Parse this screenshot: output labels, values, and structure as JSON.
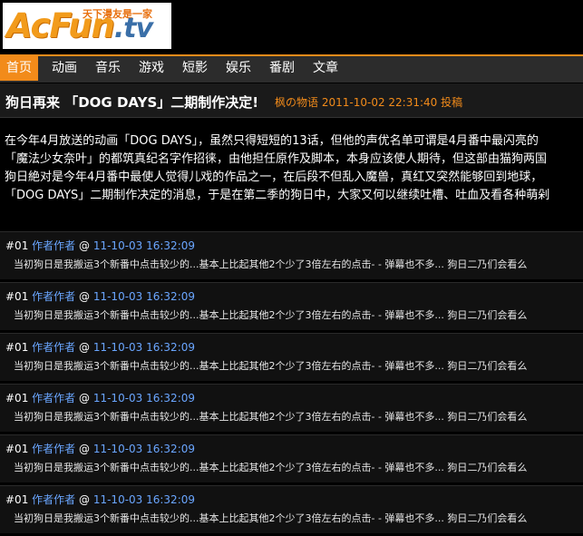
{
  "logo": {
    "brand_a": "AcFun",
    "brand_b": ".tv",
    "slogan": "天下漫友是一家"
  },
  "nav": {
    "items": [
      {
        "label": "首页",
        "active": true
      },
      {
        "label": "动画",
        "active": false
      },
      {
        "label": "音乐",
        "active": false
      },
      {
        "label": "游戏",
        "active": false
      },
      {
        "label": "短影",
        "active": false
      },
      {
        "label": "娱乐",
        "active": false
      },
      {
        "label": "番剧",
        "active": false
      },
      {
        "label": "文章",
        "active": false
      }
    ]
  },
  "article": {
    "title": "狗日再来 「DOG DAYS」二期制作决定!",
    "author": "枫の物语",
    "date": "2011-10-02 22:31:40",
    "action": "投稿",
    "body_lines": [
      "在今年4月放送的动画「DOG DAYS」，虽然只得短短的13话，但他的声优名单可谓是4月番中最闪亮的",
      "「魔法少女奈叶」的都筑真纪名字作招徕，由他担任原作及脚本，本身应该使人期待，但这部由猫狗两国",
      "狗日絶对是今年4月番中最使人觉得儿戏的作品之一，在后段不但乱入魔兽，真红又突然能够回到地球，",
      "「DOG DAYS」二期制作决定的消息，于是在第二季的狗日中，大家又何以继续吐槽、吐血及看各种萌剁"
    ]
  },
  "comments": [
    {
      "num": "#01",
      "author": "作者作者",
      "at": "@",
      "time": "11-10-03 16:32:09",
      "text": "当初狗日是我搬运3个新番中点击较少的...基本上比起其他2个少了3倍左右的点击- - 弹幕也不多... 狗日二乃们会看么"
    },
    {
      "num": "#01",
      "author": "作者作者",
      "at": "@",
      "time": "11-10-03 16:32:09",
      "text": "当初狗日是我搬运3个新番中点击较少的...基本上比起其他2个少了3倍左右的点击- - 弹幕也不多... 狗日二乃们会看么"
    },
    {
      "num": "#01",
      "author": "作者作者",
      "at": "@",
      "time": "11-10-03 16:32:09",
      "text": "当初狗日是我搬运3个新番中点击较少的...基本上比起其他2个少了3倍左右的点击- - 弹幕也不多... 狗日二乃们会看么"
    },
    {
      "num": "#01",
      "author": "作者作者",
      "at": "@",
      "time": "11-10-03 16:32:09",
      "text": "当初狗日是我搬运3个新番中点击较少的...基本上比起其他2个少了3倍左右的点击- - 弹幕也不多... 狗日二乃们会看么"
    },
    {
      "num": "#01",
      "author": "作者作者",
      "at": "@",
      "time": "11-10-03 16:32:09",
      "text": "当初狗日是我搬运3个新番中点击较少的...基本上比起其他2个少了3倍左右的点击- - 弹幕也不多... 狗日二乃们会看么"
    },
    {
      "num": "#01",
      "author": "作者作者",
      "at": "@",
      "time": "11-10-03 16:32:09",
      "text": "当初狗日是我搬运3个新番中点击较少的...基本上比起其他2个少了3倍左右的点击- - 弹幕也不多... 狗日二乃们会看么"
    }
  ],
  "colors": {
    "accent": "#f28b1a",
    "link": "#6aa6ff",
    "background": "#000000"
  }
}
